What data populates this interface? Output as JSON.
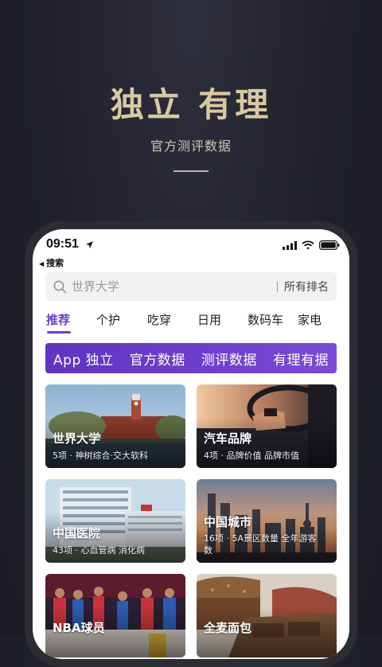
{
  "hero": {
    "title": "独立 有理",
    "subtitle": "官方测评数据"
  },
  "status_bar": {
    "time": "09:51"
  },
  "nav": {
    "back_label": "搜索"
  },
  "search": {
    "placeholder": "世界大学",
    "ranking_link": "所有排名"
  },
  "tabs": [
    {
      "label": "推荐",
      "active": true
    },
    {
      "label": "个护"
    },
    {
      "label": "吃穿"
    },
    {
      "label": "日用"
    },
    {
      "label": "数码车"
    },
    {
      "label": "家电"
    }
  ],
  "banner": {
    "items": [
      "App 独立",
      "官方数据",
      "测评数据",
      "有理有据"
    ]
  },
  "cards": [
    {
      "title": "世界大学",
      "desc": "5项 · 神树综合·交大软科"
    },
    {
      "title": "汽车品牌",
      "desc": "4项 · 品牌价值 品牌市值"
    },
    {
      "title": "中国医院",
      "desc": "43项 · 心血管病 消化病"
    },
    {
      "title": "中国城市",
      "desc": "16项 · 5A景区数量 全年游客数"
    },
    {
      "title": "NBA球员",
      "desc": ""
    },
    {
      "title": "全麦面包",
      "desc": ""
    }
  ],
  "colors": {
    "accent": "#6a3fd0",
    "hero_text": "#d9c9a3",
    "background": "#1f2029"
  }
}
